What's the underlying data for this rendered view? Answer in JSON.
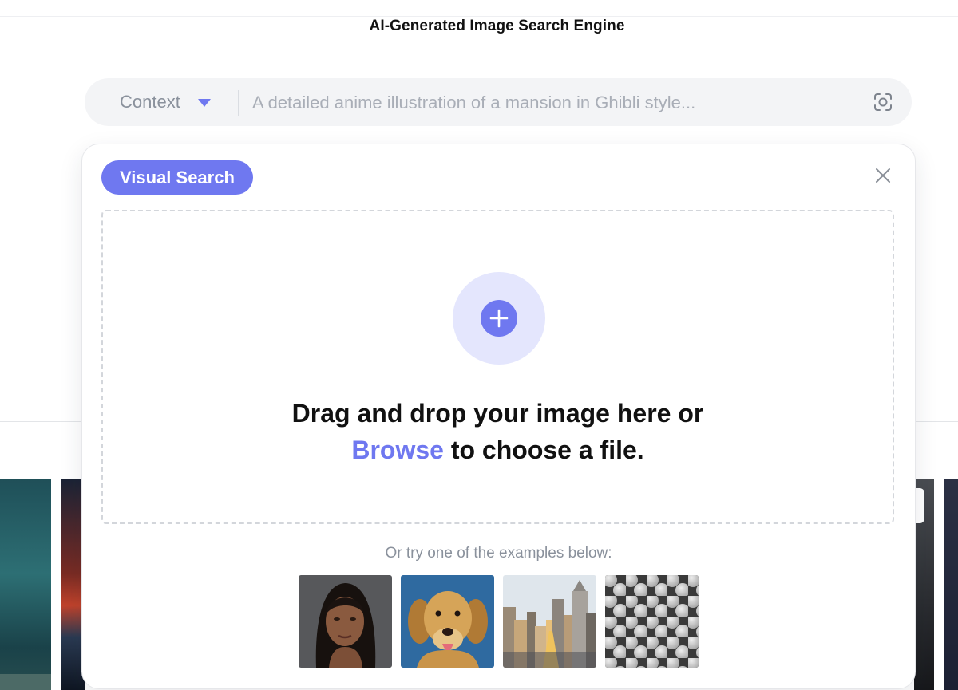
{
  "page": {
    "title": "AI-Generated Image Search Engine"
  },
  "search": {
    "context_label": "Context",
    "placeholder": "A detailed anime illustration of a mansion in Ghibli style...",
    "icons": {
      "caret": "chevron-down-icon",
      "lens": "image-search-icon"
    }
  },
  "modal": {
    "badge": "Visual Search",
    "close_icon": "close-icon",
    "dropzone": {
      "add_icon": "plus-icon",
      "line1": "Drag and drop your image here or",
      "browse": "Browse",
      "line2_rest": " to choose a file."
    },
    "examples_caption": "Or try one of the examples below:",
    "examples": [
      "woman-portrait",
      "golden-retriever",
      "city-skyline",
      "gray-dot-pattern"
    ]
  },
  "colors": {
    "accent": "#6f78f0",
    "accent_soft": "#e4e6fd",
    "bar_bg": "#f3f4f6",
    "muted_text": "#8a919c"
  }
}
